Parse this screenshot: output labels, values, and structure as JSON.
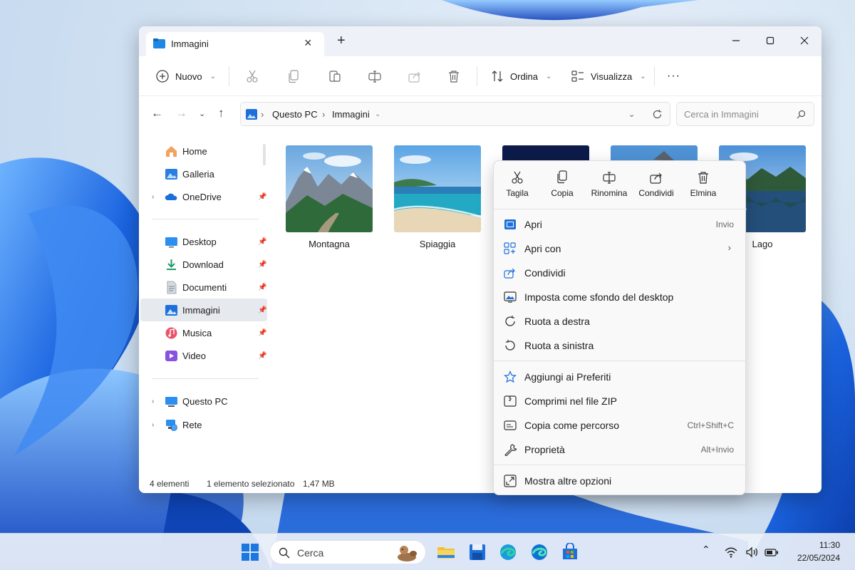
{
  "window": {
    "tab_title": "Immagini",
    "toolbar": {
      "new_label": "Nuovo",
      "sort_label": "Ordina",
      "view_label": "Visualizza",
      "more_label": "···"
    },
    "breadcrumb": [
      "Questo PC",
      "Immagini"
    ],
    "search_placeholder": "Cerca in Immagini",
    "sidebar": {
      "group1": [
        {
          "label": "Home",
          "icon": "home-icon",
          "expand": false,
          "pin": false
        },
        {
          "label": "Galleria",
          "icon": "gallery-icon",
          "expand": false,
          "pin": false
        },
        {
          "label": "OneDrive",
          "icon": "onedrive-icon",
          "expand": true,
          "pin": true
        }
      ],
      "group2": [
        {
          "label": "Desktop",
          "icon": "desktop-icon",
          "pin": true
        },
        {
          "label": "Download",
          "icon": "download-icon",
          "pin": true
        },
        {
          "label": "Documenti",
          "icon": "documents-icon",
          "pin": true
        },
        {
          "label": "Immagini",
          "icon": "pictures-icon",
          "pin": true,
          "selected": true
        },
        {
          "label": "Musica",
          "icon": "music-icon",
          "pin": true
        },
        {
          "label": "Video",
          "icon": "video-icon",
          "pin": true
        }
      ],
      "group3": [
        {
          "label": "Questo PC",
          "icon": "this-pc-icon",
          "expand": true
        },
        {
          "label": "Rete",
          "icon": "network-icon",
          "expand": true
        }
      ]
    },
    "files": [
      {
        "name": "Montagna",
        "image": "mountain-photo"
      },
      {
        "name": "Spiaggia",
        "image": "beach-photo"
      },
      {
        "name": "",
        "image": "night-photo"
      },
      {
        "name": "",
        "image": "mountain-lake-photo"
      },
      {
        "name": "Lago",
        "image": "lake-photo"
      }
    ],
    "status": {
      "count": "4 elementi",
      "selection": "1 elemento selezionato",
      "size": "1,47 MB"
    }
  },
  "context_menu": {
    "quick_actions": [
      {
        "label": "Tagila",
        "icon": "cut-icon"
      },
      {
        "label": "Copia",
        "icon": "copy-icon"
      },
      {
        "label": "Rinomina",
        "icon": "rename-icon"
      },
      {
        "label": "Condividi",
        "icon": "share-icon"
      },
      {
        "label": "Elmina",
        "icon": "delete-icon"
      }
    ],
    "items": [
      {
        "label": "Apri",
        "shortcut": "Invio",
        "icon": "open-icon"
      },
      {
        "label": "Apri con",
        "shortcut": "",
        "icon": "open-with-icon",
        "submenu": true
      },
      {
        "label": "Condividi",
        "shortcut": "",
        "icon": "share-icon"
      },
      {
        "label": "Imposta come sfondo del desktop",
        "shortcut": "",
        "icon": "wallpaper-icon"
      },
      {
        "label": "Ruota a destra",
        "shortcut": "",
        "icon": "rotate-right-icon"
      },
      {
        "label": "Ruota a sinistra",
        "shortcut": "",
        "icon": "rotate-left-icon"
      },
      {
        "label": "Aggiungi ai Preferiti",
        "shortcut": "",
        "icon": "star-icon"
      },
      {
        "label": "Comprimi nel file ZIP",
        "shortcut": "",
        "icon": "zip-icon"
      },
      {
        "label": "Copia come percorso",
        "shortcut": "Ctrl+Shift+C",
        "icon": "copy-path-icon"
      },
      {
        "label": "Proprietà",
        "shortcut": "Alt+Invio",
        "icon": "properties-icon"
      },
      {
        "label": "Mostra altre opzioni",
        "shortcut": "",
        "icon": "more-options-icon"
      }
    ]
  },
  "taskbar": {
    "search_label": "Cerca",
    "time": "11:30",
    "date": "22/05/2024"
  },
  "colors": {
    "accent": "#0067c0",
    "wallpaper_blue": "#1a5fd8"
  }
}
